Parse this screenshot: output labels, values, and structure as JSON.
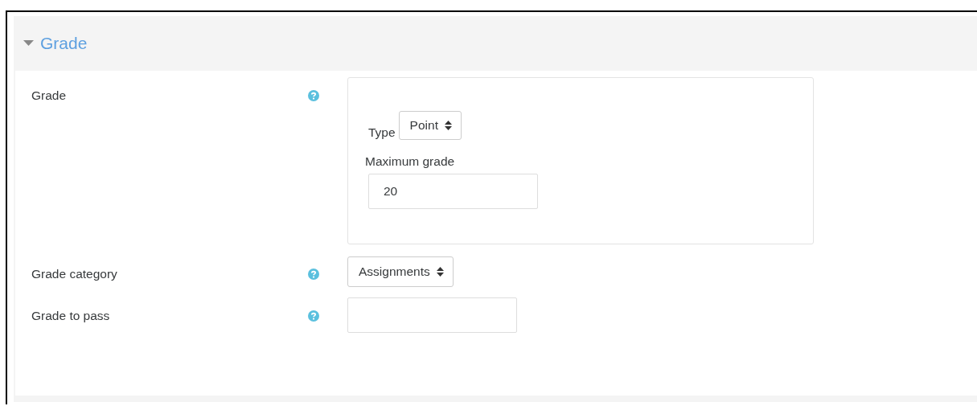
{
  "section": {
    "title": "Grade",
    "expanded": true
  },
  "fields": [
    {
      "kind": "group",
      "label": "Grade",
      "type_label": "Type",
      "type_value": "Point",
      "max_label": "Maximum grade",
      "max_value": "20"
    },
    {
      "kind": "select",
      "label": "Grade category",
      "value": "Assignments"
    },
    {
      "kind": "text",
      "label": "Grade to pass"
    }
  ]
}
